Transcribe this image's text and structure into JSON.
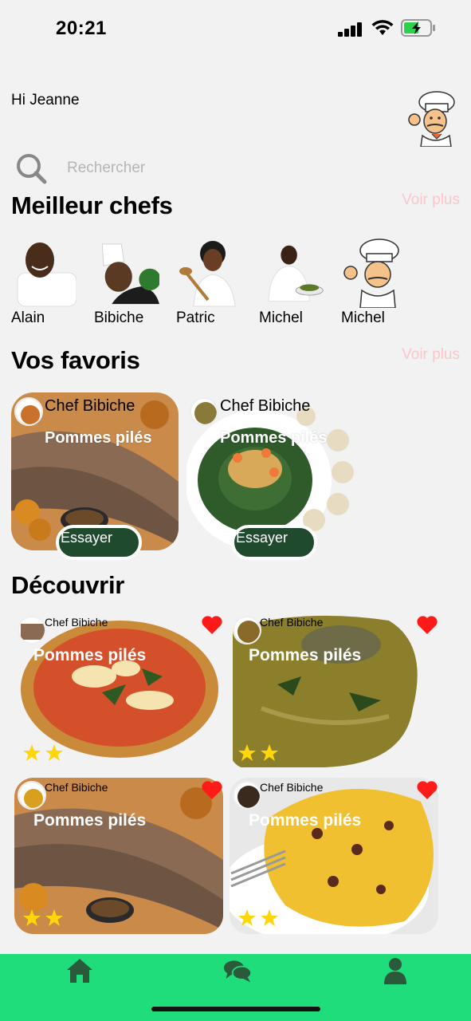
{
  "status": {
    "time": "20:21"
  },
  "header": {
    "greeting": "Hi Jeanne"
  },
  "search": {
    "placeholder": "Rechercher"
  },
  "best_chefs": {
    "title": "Meilleur chefs",
    "more": "Voir plus",
    "chefs": [
      {
        "name": "Alain"
      },
      {
        "name": "Bibiche"
      },
      {
        "name": "Patric"
      },
      {
        "name": "Michel"
      },
      {
        "name": "Michel"
      }
    ]
  },
  "favorites": {
    "title": "Vos favoris",
    "more": "Voir plus",
    "cards": [
      {
        "chef": "Chef Bibiche",
        "dish": "Pommes pilés",
        "button": "Essayer"
      },
      {
        "chef": "Chef Bibiche",
        "dish": "Pommes pilés",
        "button": "Essayer"
      }
    ]
  },
  "discover": {
    "title": "Découvrir",
    "cards": [
      {
        "chef": "Chef Bibiche",
        "dish": "Pommes pilés",
        "stars": 2
      },
      {
        "chef": "Chef Bibiche",
        "dish": "Pommes pilés",
        "stars": 2
      },
      {
        "chef": "Chef Bibiche",
        "dish": "Pommes pilés",
        "stars": 2
      },
      {
        "chef": "Chef Bibiche",
        "dish": "Pommes pilés",
        "stars": 2
      }
    ]
  },
  "nav": {
    "items": [
      "home-icon",
      "chat-icon",
      "profile-icon"
    ]
  },
  "colors": {
    "accent": "#1fdd7b",
    "button": "#1f4a2e",
    "heart": "#ff1a1a",
    "star": "#ffd60a",
    "voir_plus": "#f8c7cc"
  }
}
